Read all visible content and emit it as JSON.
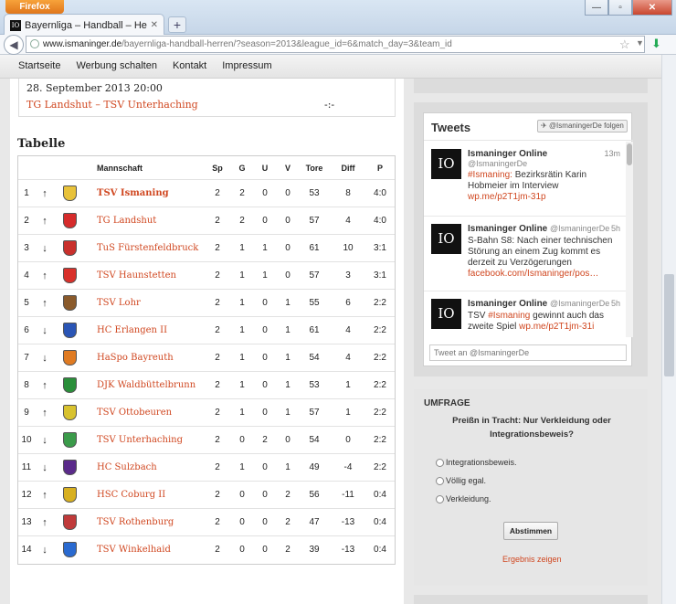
{
  "browser": {
    "app_button": "Firefox",
    "tab_title": "Bayernliga – Handball – Herren – Ismani...",
    "url_host": "www.ismaninger.de",
    "url_path": "/bayernliga-handball-herren/?season=2013&league_id=6&match_day=3&team_id"
  },
  "menu": [
    "Startseite",
    "Werbung schalten",
    "Kontakt",
    "Impressum"
  ],
  "match": {
    "date": "28. September 2013 20:00",
    "teams": "TG Landshut – TSV Unterhaching",
    "score": "-:-"
  },
  "table": {
    "heading": "Tabelle",
    "columns": {
      "team": "Mannschaft",
      "sp": "Sp",
      "g": "G",
      "u": "U",
      "v": "V",
      "tore": "Tore",
      "diff": "Diff",
      "p": "P"
    },
    "rows": [
      {
        "rank": "1",
        "trend": "↑",
        "team": "TSV Ismaning",
        "sp": "2",
        "g": "2",
        "u": "0",
        "v": "0",
        "tore": "53",
        "diff": "8",
        "p": "4:0",
        "logo_color": "#e8c23a"
      },
      {
        "rank": "2",
        "trend": "↑",
        "team": "TG Landshut",
        "sp": "2",
        "g": "2",
        "u": "0",
        "v": "0",
        "tore": "57",
        "diff": "4",
        "p": "4:0",
        "logo_color": "#d62b2b"
      },
      {
        "rank": "3",
        "trend": "↓",
        "team": "TuS Fürstenfeldbruck",
        "sp": "2",
        "g": "1",
        "u": "1",
        "v": "0",
        "tore": "61",
        "diff": "10",
        "p": "3:1",
        "logo_color": "#c9302c"
      },
      {
        "rank": "4",
        "trend": "↑",
        "team": "TSV Haunstetten",
        "sp": "2",
        "g": "1",
        "u": "1",
        "v": "0",
        "tore": "57",
        "diff": "3",
        "p": "3:1",
        "logo_color": "#d9302a"
      },
      {
        "rank": "5",
        "trend": "↑",
        "team": "TSV Lohr",
        "sp": "2",
        "g": "1",
        "u": "0",
        "v": "1",
        "tore": "55",
        "diff": "6",
        "p": "2:2",
        "logo_color": "#8a5a2b"
      },
      {
        "rank": "6",
        "trend": "↓",
        "team": "HC Erlangen II",
        "sp": "2",
        "g": "1",
        "u": "0",
        "v": "1",
        "tore": "61",
        "diff": "4",
        "p": "2:2",
        "logo_color": "#2a55b5"
      },
      {
        "rank": "7",
        "trend": "↓",
        "team": "HaSpo Bayreuth",
        "sp": "2",
        "g": "1",
        "u": "0",
        "v": "1",
        "tore": "54",
        "diff": "4",
        "p": "2:2",
        "logo_color": "#e07b22"
      },
      {
        "rank": "8",
        "trend": "↑",
        "team": "DJK Waldbüttelbrunn",
        "sp": "2",
        "g": "1",
        "u": "0",
        "v": "1",
        "tore": "53",
        "diff": "1",
        "p": "2:2",
        "logo_color": "#2a8f3a"
      },
      {
        "rank": "9",
        "trend": "↑",
        "team": "TSV Ottobeuren",
        "sp": "2",
        "g": "1",
        "u": "0",
        "v": "1",
        "tore": "57",
        "diff": "1",
        "p": "2:2",
        "logo_color": "#d8c22e"
      },
      {
        "rank": "10",
        "trend": "↓",
        "team": "TSV Unterhaching",
        "sp": "2",
        "g": "0",
        "u": "2",
        "v": "0",
        "tore": "54",
        "diff": "0",
        "p": "2:2",
        "logo_color": "#3b9b4a"
      },
      {
        "rank": "11",
        "trend": "↓",
        "team": "HC Sulzbach",
        "sp": "2",
        "g": "1",
        "u": "0",
        "v": "1",
        "tore": "49",
        "diff": "-4",
        "p": "2:2",
        "logo_color": "#5a2a8a"
      },
      {
        "rank": "12",
        "trend": "↑",
        "team": "HSC Coburg II",
        "sp": "2",
        "g": "0",
        "u": "0",
        "v": "2",
        "tore": "56",
        "diff": "-11",
        "p": "0:4",
        "logo_color": "#d8b020"
      },
      {
        "rank": "13",
        "trend": "↑",
        "team": "TSV Rothenburg",
        "sp": "2",
        "g": "0",
        "u": "0",
        "v": "2",
        "tore": "47",
        "diff": "-13",
        "p": "0:4",
        "logo_color": "#c03a3a"
      },
      {
        "rank": "14",
        "trend": "↓",
        "team": "TSV Winkelhaid",
        "sp": "2",
        "g": "0",
        "u": "0",
        "v": "2",
        "tore": "39",
        "diff": "-13",
        "p": "0:4",
        "logo_color": "#2a6ad0"
      }
    ]
  },
  "tweets": {
    "title": "Tweets",
    "follow": "@IsmaningerDe folgen",
    "input_placeholder": "Tweet an @IsmaningerDe",
    "items": [
      {
        "name": "Ismaninger Online",
        "handle": "@IsmaningerDe",
        "time": "13m",
        "hashtag": "#Ismaning:",
        "text": "Bezirksrätin Karin Hobmeier im Interview",
        "link": "wp.me/p2T1jm-31p"
      },
      {
        "name": "Ismaninger Online",
        "handle": "@IsmaningerDe",
        "time": "5h",
        "hashtag": "",
        "text": "S-Bahn S8: Nach einer technischen Störung an einem Zug kommt es derzeit zu Verzögerungen",
        "link": "facebook.com/Ismaninger/pos…"
      },
      {
        "name": "Ismaninger Online",
        "handle": "@IsmaningerDe",
        "time": "5h",
        "hashtag": "#Ismaning",
        "text_pre": "TSV",
        "text": "gewinnt auch das zweite Spiel",
        "link": "wp.me/p2T1jm-31i"
      }
    ]
  },
  "poll": {
    "title": "UMFRAGE",
    "question": "Preißn in Tracht: Nur Verkleidung oder Integrationsbeweis?",
    "options": [
      "Integrationsbeweis.",
      "Völlig egal.",
      "Verkleidung."
    ],
    "vote_label": "Abstimmen",
    "results_label": "Ergebnis zeigen"
  },
  "colors": {
    "link": "#d04720",
    "accent_orange": "#e0761b"
  },
  "icons": [
    "favicon-io-icon",
    "back-arrow-icon",
    "globe-icon",
    "star-icon",
    "download-icon",
    "twitter-bird-icon",
    "radio-icon"
  ]
}
